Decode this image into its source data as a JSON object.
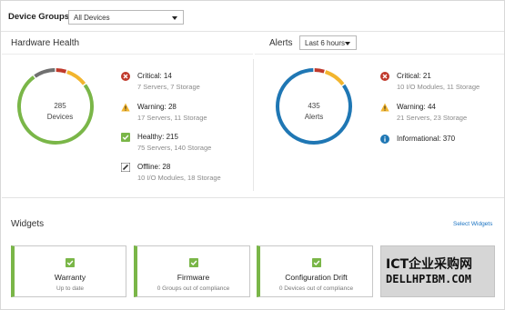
{
  "header": {
    "device_groups_label": "Device Groups",
    "device_groups_value": "All Devices"
  },
  "hardware_health": {
    "title": "Hardware Health",
    "donut_total": "285",
    "donut_label": "Devices",
    "items": [
      {
        "icon": "critical-x-icon",
        "title": "Critical: 14",
        "sub": "7 Servers, 7 Storage"
      },
      {
        "icon": "warning-triangle-icon",
        "title": "Warning: 28",
        "sub": "17 Servers, 11 Storage"
      },
      {
        "icon": "healthy-check-icon",
        "title": "Healthy: 215",
        "sub": "75 Servers, 140 Storage"
      },
      {
        "icon": "offline-pencil-icon",
        "title": "Offline: 28",
        "sub": "10 I/O Modules, 18 Storage"
      }
    ],
    "donut_values": {
      "critical": 14,
      "warning": 28,
      "healthy": 215,
      "offline": 28
    }
  },
  "alerts": {
    "title": "Alerts",
    "time_value": "Last 6 hours",
    "donut_total": "435",
    "donut_label": "Alerts",
    "items": [
      {
        "icon": "critical-x-icon",
        "title": "Critical: 21",
        "sub": "10 I/O Modules, 11 Storage"
      },
      {
        "icon": "warning-triangle-icon",
        "title": "Warning: 44",
        "sub": "21 Servers, 23 Storage"
      },
      {
        "icon": "info-icon",
        "title": "Informational: 370",
        "sub": ""
      }
    ],
    "donut_values": {
      "critical": 21,
      "warning": 44,
      "informational": 370
    }
  },
  "widgets": {
    "title": "Widgets",
    "select_label": "Select Widgets",
    "cards": [
      {
        "title": "Warranty",
        "sub": "Up to date"
      },
      {
        "title": "Firmware",
        "sub": "0 Groups out of compliance"
      },
      {
        "title": "Configuration Drift",
        "sub": "0 Devices out of compliance"
      }
    ]
  },
  "watermark": {
    "line1": "ICT企业采购网",
    "line2": "DELLHPIBM.COM"
  },
  "colors": {
    "critical": "#c0392b",
    "warning": "#f2b52e",
    "healthy": "#7ab648",
    "offline": "#707070",
    "info": "#1f77b4",
    "accent_blue": "#1a73c2"
  }
}
